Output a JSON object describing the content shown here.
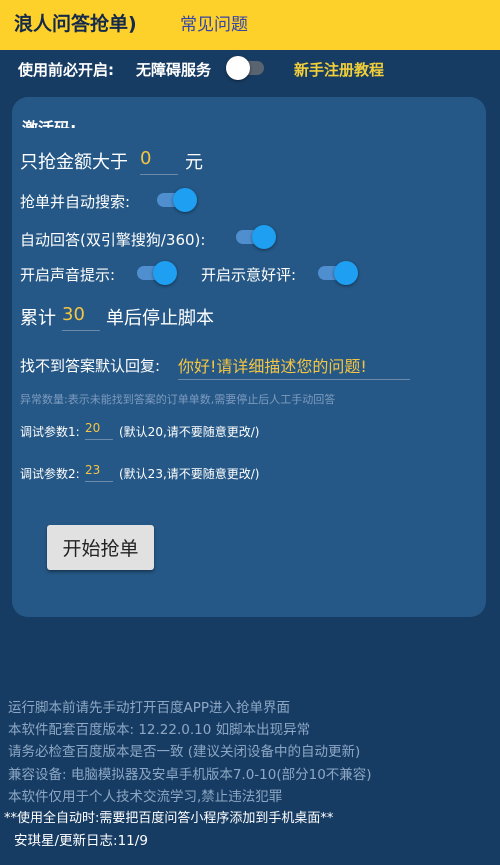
{
  "header": {
    "title": "浪人问答抢单)",
    "faq_link": "常见问题"
  },
  "prereq": {
    "label": "使用前必开启:",
    "accessibility_label": "无障碍服务",
    "accessibility_on": false,
    "tutorial_link": "新手注册教程"
  },
  "card": {
    "header_partial": "激活码:",
    "min_amount": {
      "label": "只抢金额大于",
      "value": "0",
      "unit": "元"
    },
    "auto_search": {
      "label": "抢单并自动搜索:",
      "on": true
    },
    "auto_answer": {
      "label": "自动回答(双引擎搜狗/360):",
      "on": true
    },
    "sound": {
      "label": "开启声音提示:",
      "on": true
    },
    "good_review": {
      "label": "开启示意好评:",
      "on": true
    },
    "stop_after": {
      "prefix": "累计",
      "value": "30",
      "suffix": "单后停止脚本"
    },
    "default_reply": {
      "label": "找不到答案默认回复:",
      "value": "你好!请详细描述您的问题!"
    },
    "error_note": "异常数量:表示未能找到答案的订单单数,需要停止后人工手动回答",
    "param1": {
      "label": "调试参数1:",
      "value": "20",
      "hint": "(默认20,请不要随意更改/)"
    },
    "param2": {
      "label": "调试参数2:",
      "value": "23",
      "hint": "(默认23,请不要随意更改/)"
    },
    "start_button": "开始抢单"
  },
  "info_lines": [
    "运行脚本前请先手动打开百度APP进入抢单界面",
    "本软件配套百度版本: 12.22.0.10  如脚本出现异常",
    "请务必检查百度版本是否一致 (建议关闭设备中的自动更新)",
    "兼容设备: 电脑模拟器及安卓手机版本7.0-10(部分10不兼容)",
    "本软件仅用于个人技术交流学习,禁止违法犯罪"
  ],
  "footer": {
    "warning": "**使用全自动时:需要把百度问答小程序添加到手机桌面**",
    "changelog": "安琪星/更新日志:11/9"
  },
  "colors": {
    "background": "#173c63",
    "card": "#255887",
    "header": "#fdd02a",
    "accent_yellow": "#f5c542",
    "switch_on": "#1e9ff2"
  }
}
